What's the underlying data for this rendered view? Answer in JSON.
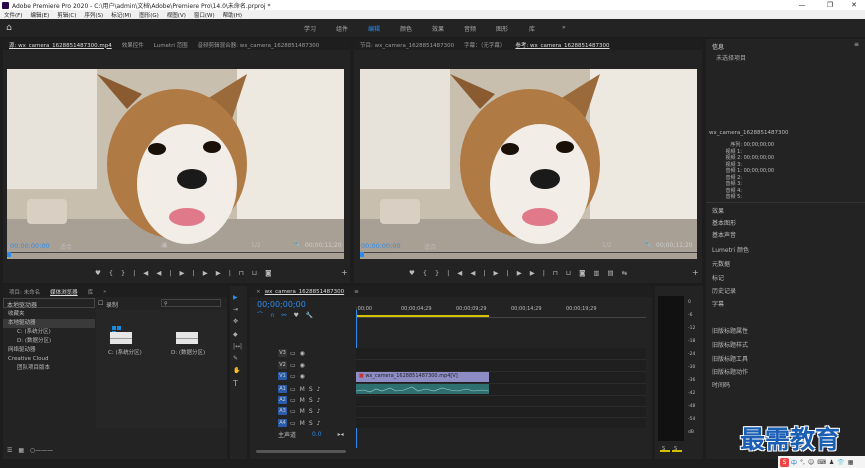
{
  "title": "Adobe Premiere Pro 2020 - C:\\用户\\admin\\文档\\Adobe\\Premiere Pro\\14.0\\未命名.prproj *",
  "menu": [
    "文件(F)",
    "编辑(E)",
    "剪辑(C)",
    "序列(S)",
    "标记(M)",
    "图形(G)",
    "视图(V)",
    "窗口(W)",
    "帮助(H)"
  ],
  "workspaces": [
    "学习",
    "组件",
    "编辑",
    "颜色",
    "效果",
    "音频",
    "图形",
    "库"
  ],
  "source": {
    "tabs": [
      "源: wx_camera_1628851487300.mp4",
      "效果控件",
      "Lumetri 范围",
      "音频剪辑混合器: wx_camera_1628851487300"
    ],
    "timecode": "00;00;00;00",
    "fit": "适合",
    "scale": "1/2",
    "duration": "00;00;11;20"
  },
  "program": {
    "tabs": [
      "节目: wx_camera_1628851487300",
      "字幕：（无字幕）",
      "参考: wx_camera_1628851487300"
    ],
    "timecode": "00;00;00;00",
    "fit": "适合",
    "scale": "1/2",
    "duration": "00;00;11;20"
  },
  "info": {
    "title": "信息",
    "no_selection": "未选择项目",
    "clip_name": "wx_camera_1628851487300",
    "rows": [
      {
        "label": "序列:",
        "value": "00;00;00;00"
      },
      {
        "label": "视频 1:",
        "value": ""
      },
      {
        "label": "视频 2:",
        "value": "00;00;00;00"
      },
      {
        "label": "视频 3:",
        "value": ""
      },
      {
        "label": "音频 1:",
        "value": "00;00;00;00"
      },
      {
        "label": "音频 2:",
        "value": ""
      },
      {
        "label": "音频 3:",
        "value": ""
      },
      {
        "label": "音频 4:",
        "value": ""
      },
      {
        "label": "音频 5:",
        "value": ""
      }
    ],
    "panels": [
      "效果",
      "基本图形",
      "基本声音",
      "Lumetri 颜色",
      "元数据",
      "标记",
      "历史记录",
      "字幕",
      "旧版标题属性",
      "旧版标题样式",
      "旧版标题工具",
      "旧版标题动作",
      "时间码"
    ]
  },
  "media": {
    "tabs": [
      "项目: 未命名",
      "媒体浏览器",
      "库"
    ],
    "location": "本地驱动器",
    "tree": [
      "收藏夹",
      "本地驱动器",
      "C: (系统分区)",
      "D: (数据分区)",
      "网络驱动器",
      "Creative Cloud",
      "团队项目版本"
    ],
    "drives": [
      "C: (系统分区)",
      "D: (数据分区)"
    ],
    "record_label": "录制"
  },
  "timeline": {
    "tab": "wx_camera_1628851487300",
    "timecode": "00;00;00;00",
    "ruler": [
      ":00;00",
      "00;00;04;29",
      "00;00;09;29",
      "00;00;14;29",
      "00;00;19;29"
    ],
    "video_tracks": [
      "V3",
      "V2",
      "V1"
    ],
    "audio_tracks": [
      "A1",
      "A2",
      "A3",
      "A4"
    ],
    "master": "主声道",
    "master_value": "0.0",
    "clip": "wx_camera_1628851487300.mp4[V]"
  },
  "meter": {
    "labels": [
      "0",
      "-6",
      "-12",
      "-18",
      "-24",
      "-30",
      "-36",
      "-42",
      "-48",
      "-54",
      "dB"
    ],
    "channel_labels": [
      "S",
      "S"
    ]
  },
  "watermark": "最需教育",
  "tray": [
    "中",
    "°,",
    "☺",
    "⌨",
    "♟",
    "👕",
    "▦"
  ]
}
